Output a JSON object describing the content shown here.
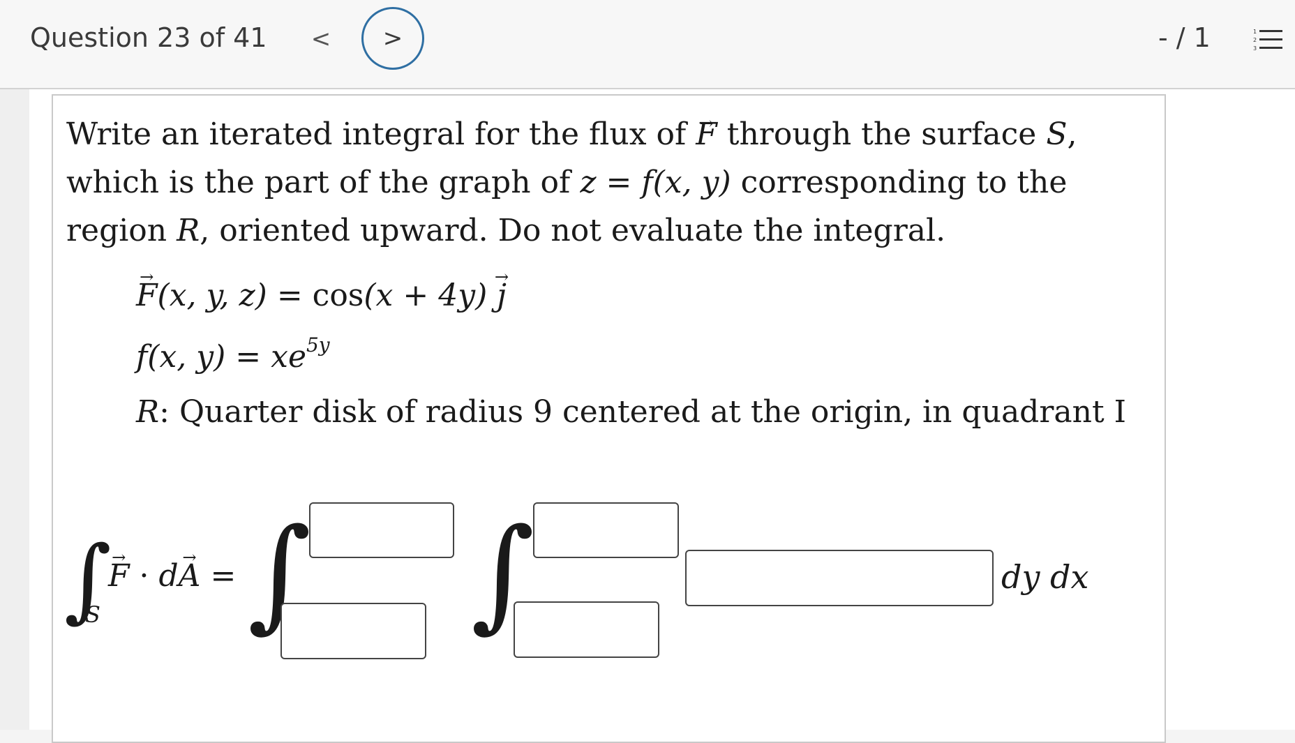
{
  "header": {
    "question_label": "Question 23 of 41",
    "prev_glyph": "<",
    "next_glyph": ">",
    "score": "- / 1",
    "menu_icon": "numbered-list-icon",
    "accent_color": "#2f6fa3"
  },
  "problem": {
    "prompt_line1_a": "Write an iterated integral for the flux of ",
    "prompt_F": "F",
    "prompt_line1_b": " through the surface ",
    "prompt_S": "S",
    "prompt_line1_c": ",",
    "prompt_line2_a": "which is the part of the graph of ",
    "prompt_z": "z",
    "prompt_eq": " = ",
    "prompt_fxy": "f(x, y)",
    "prompt_line2_b": " corresponding to the",
    "prompt_line3_a": "region ",
    "prompt_R": "R",
    "prompt_line3_b": ", oriented upward. Do not evaluate the integral.",
    "field_F": "F",
    "field_args": "(x, y, z)",
    "field_eq": " = ",
    "field_rhs_cos": "cos",
    "field_rhs_arg": "(x + 4y)",
    "field_j": "j",
    "surface_f": "f",
    "surface_args": "(x, y)",
    "surface_eq": " = ",
    "surface_base": "xe",
    "surface_exp": "5y",
    "region_R": "R",
    "region_text": ": Quarter disk of radius 9 centered at the origin, in quadrant I"
  },
  "answer": {
    "lhs_F": "F",
    "lhs_dot": " · ",
    "lhs_d": "d",
    "lhs_A": "A",
    "lhs_eq": " =",
    "lhs_sub": "S",
    "differentials": "dy dx",
    "outer_upper_value": "",
    "outer_lower_value": "",
    "inner_upper_value": "",
    "inner_lower_value": "",
    "integrand_value": ""
  }
}
